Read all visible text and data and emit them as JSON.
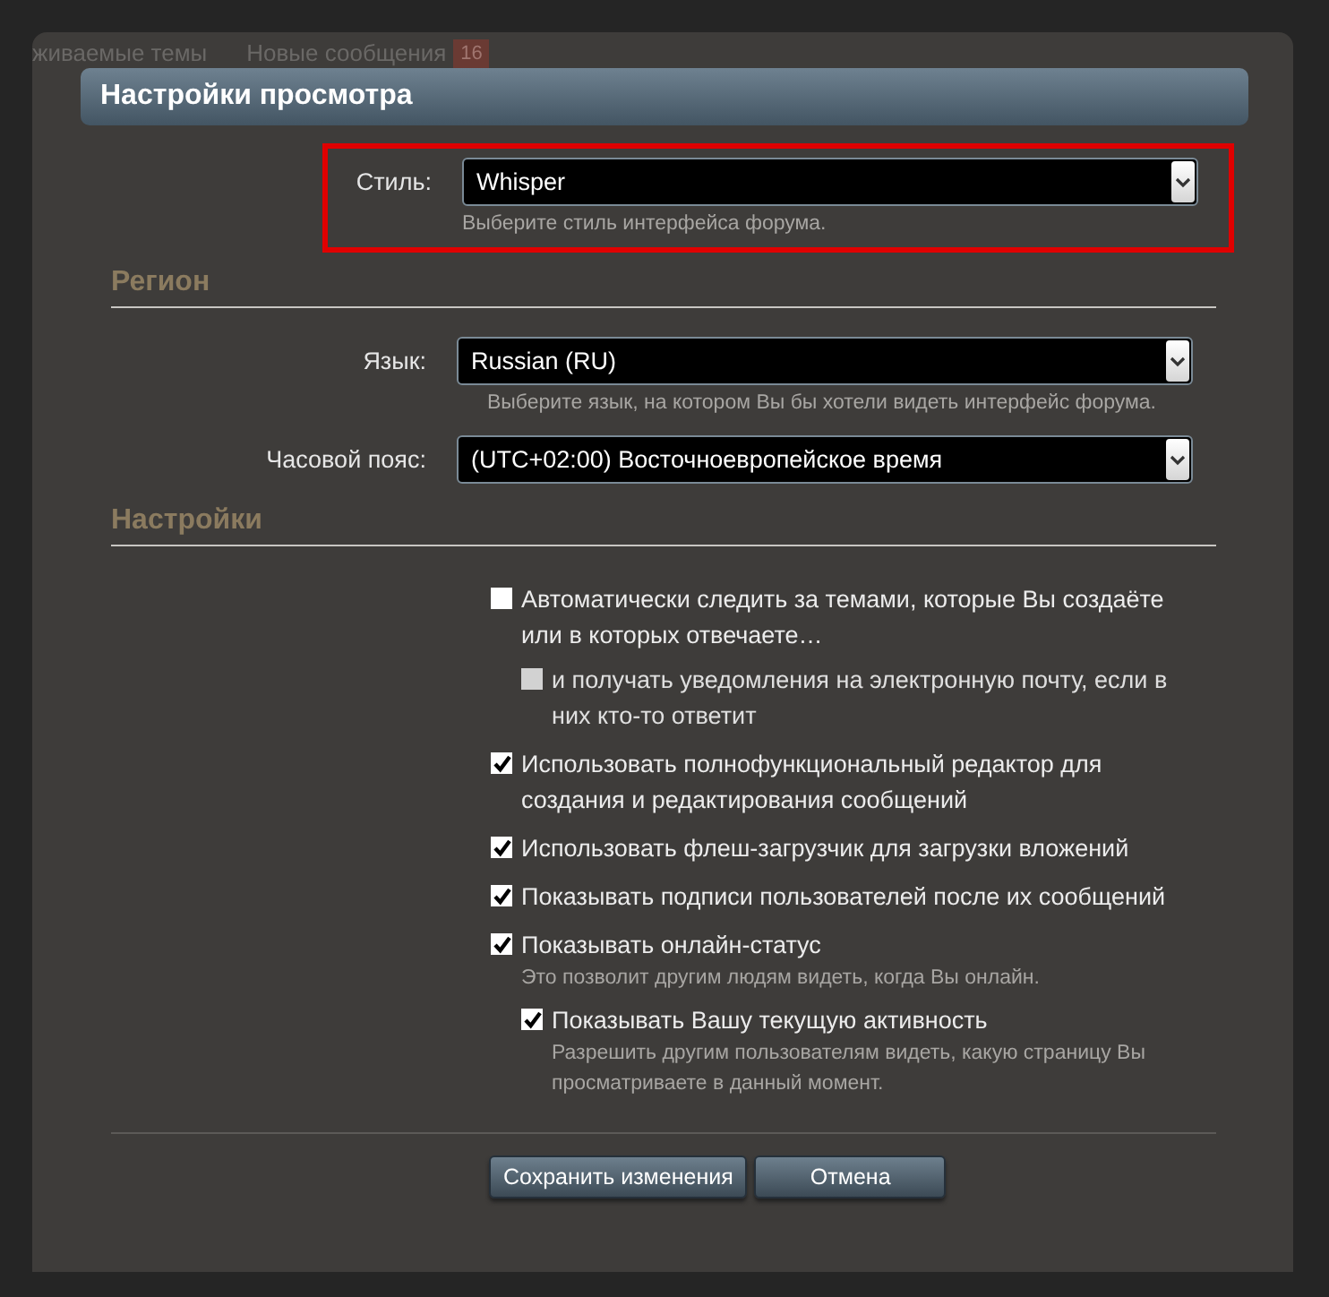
{
  "background_nav": [
    {
      "label": "живаемые темы"
    },
    {
      "label": "Новые сообщения",
      "badge": "16"
    }
  ],
  "dialog": {
    "title": "Настройки просмотра",
    "style_field": {
      "label": "Стиль:",
      "value": "Whisper",
      "hint": "Выберите стиль интерфейса форума.",
      "highlighted": true
    },
    "sections": [
      {
        "heading": "Регион",
        "fields": [
          {
            "label": "Язык:",
            "value": "Russian (RU)",
            "hint": "Выберите язык, на котором Вы бы хотели видеть интерфейс форума."
          },
          {
            "label": "Часовой пояс:",
            "value": "(UTC+02:00) Восточноевропейское время"
          }
        ]
      },
      {
        "heading": "Настройки",
        "options": [
          {
            "label": "Автоматически следить за темами, которые Вы создаёте или в которых отвечаете…",
            "checked": false,
            "disabled": false,
            "children": [
              {
                "label": "и получать уведомления на электронную почту, если в них кто-то ответит",
                "checked": false,
                "disabled": true
              }
            ]
          },
          {
            "label": "Использовать полнофункциональный редактор для создания и редактирования сообщений",
            "checked": true,
            "disabled": false
          },
          {
            "label": "Использовать флеш-загрузчик для загрузки вложений",
            "checked": true,
            "disabled": false
          },
          {
            "label": "Показывать подписи пользователей после их сообщений",
            "checked": true,
            "disabled": false
          },
          {
            "label": "Показывать онлайн-статус",
            "checked": true,
            "disabled": false,
            "hint": "Это позволит другим людям видеть, когда Вы онлайн.",
            "children": [
              {
                "label": "Показывать Вашу текущую активность",
                "checked": true,
                "disabled": false,
                "hint": "Разрешить другим пользователям видеть, какую страницу Вы просматриваете в данный момент."
              }
            ]
          }
        ]
      }
    ],
    "buttons": [
      {
        "label": "Сохранить изменения"
      },
      {
        "label": "Отмена"
      }
    ]
  }
}
